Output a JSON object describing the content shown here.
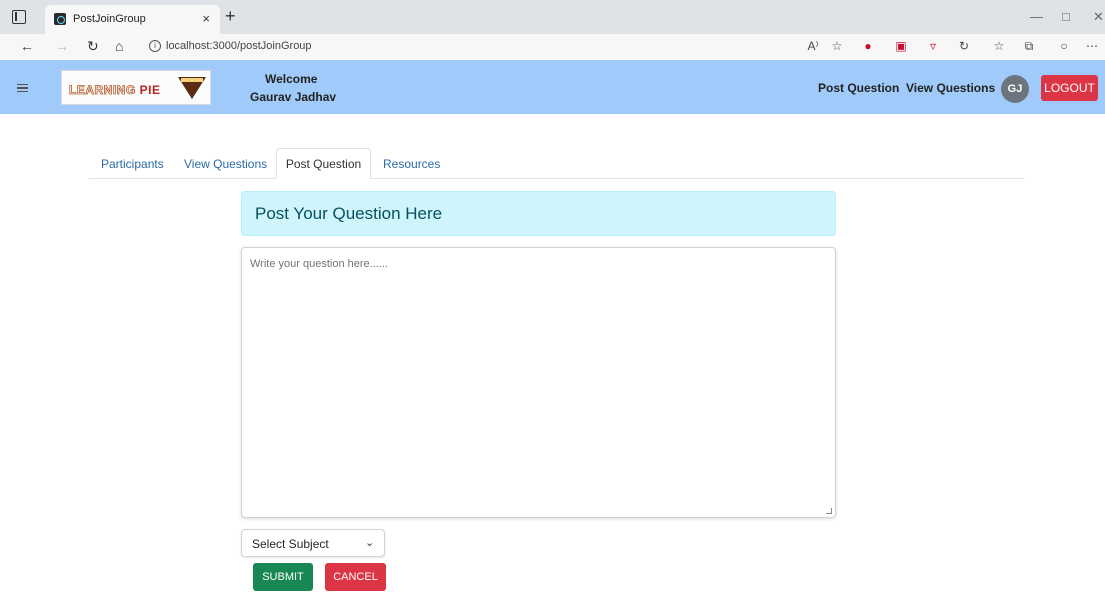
{
  "browser": {
    "tab_title": "PostJoinGroup",
    "tab_close": "×",
    "new_tab": "+",
    "url": "localhost:3000/postJoinGroup",
    "toolbar_icons": [
      "A⁾",
      "☆",
      "●",
      "▣",
      "▿",
      "↻",
      "☆",
      "⧉",
      "○",
      "⋯"
    ]
  },
  "navbar": {
    "brand_learning": "LEARNING",
    "brand_pie": "PIE",
    "welcome": "Welcome",
    "user_name": "Gaurav Jadhav",
    "links": [
      "Post Question",
      "View Questions"
    ],
    "avatar_initials": "GJ",
    "logout_label": "LOGOUT",
    "colors": {
      "bar": "#9fcaf9",
      "logout": "#dc3545",
      "avatar": "#6c757d"
    }
  },
  "tabs": {
    "items": [
      "Participants",
      "View Questions",
      "Post Question",
      "Resources"
    ],
    "active": "Post Question"
  },
  "form": {
    "heading": "Post Your Question Here",
    "question_placeholder": "Write your question here......",
    "subject_select": "Select Subject",
    "submit_label": "SUBMIT",
    "cancel_label": "CANCEL",
    "colors": {
      "submit": "#198754",
      "cancel": "#dc3545",
      "alert_bg": "#cff4fc"
    }
  }
}
